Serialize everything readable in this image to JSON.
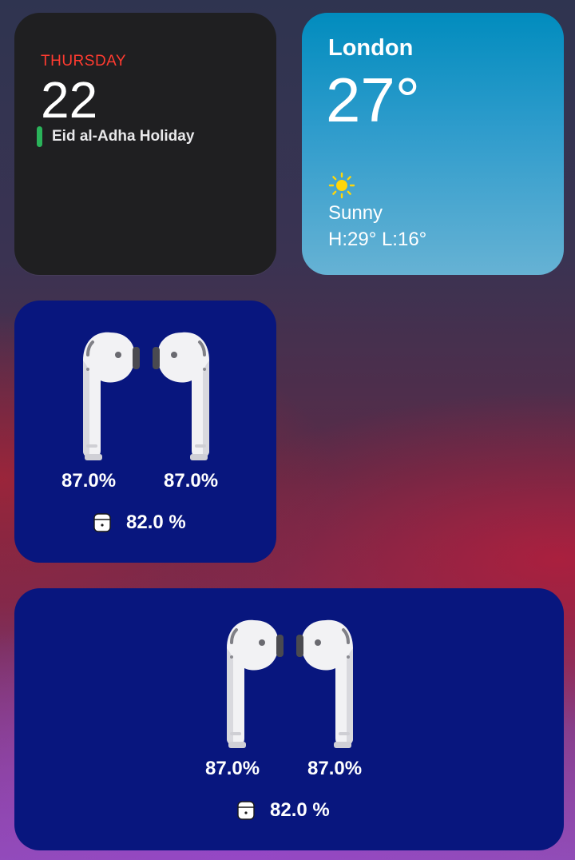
{
  "calendar": {
    "weekday": "THURSDAY",
    "date": "22",
    "event": "Eid al-Adha Holiday",
    "colors": {
      "weekday": "#ff3b30",
      "event_bar": "#2ab35a"
    }
  },
  "weather": {
    "city": "London",
    "temperature": "27°",
    "condition_icon": "sun-icon",
    "condition": "Sunny",
    "high_low": "H:29° L:16°"
  },
  "airpods_small": {
    "left_battery": "87.0%",
    "right_battery": "87.0%",
    "case_icon": "airpods-case-icon",
    "case_battery": "82.0 %"
  },
  "airpods_large": {
    "left_battery": "87.0%",
    "right_battery": "87.0%",
    "case_icon": "airpods-case-icon",
    "case_battery": "82.0 %"
  },
  "colors": {
    "airpods_widget_bg": "#08167e",
    "weather_top": "#018cbe",
    "weather_bottom": "#66b2d4"
  }
}
